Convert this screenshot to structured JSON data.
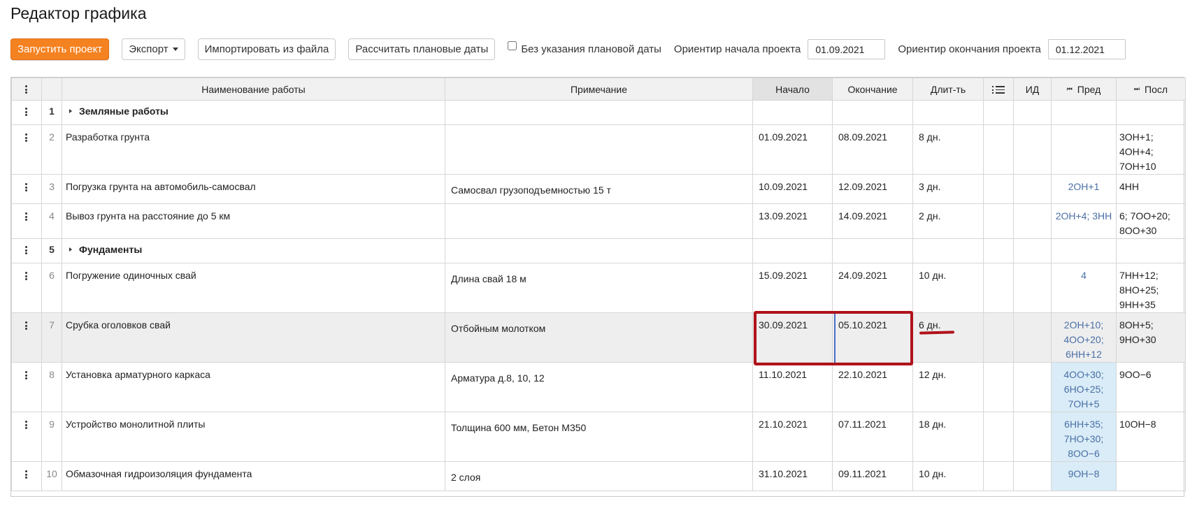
{
  "page": {
    "title": "Редактор графика"
  },
  "toolbar": {
    "run_label": "Запустить проект",
    "export_label": "Экспорт",
    "import_label": "Импортировать из файла",
    "calc_label": "Рассчитать плановые даты",
    "no_plan_date_label": "Без указания плановой даты",
    "no_plan_date_checked": false,
    "start_label": "Ориентир начала проекта",
    "start_value": "01.09.2021",
    "end_label": "Ориентир окончания проекта",
    "end_value": "01.12.2021"
  },
  "colors": {
    "primary": "#f58220",
    "link": "#4a6fa5",
    "highlight_border": "#b0121b",
    "pred_highlight": "#d9ecf7"
  },
  "table": {
    "headers": {
      "name": "Наименование работы",
      "note": "Примечание",
      "start": "Начало",
      "end": "Окончание",
      "duration": "Длит-ть",
      "list_icon": "list-icon",
      "id": "ИД",
      "pred": "Пред",
      "succ": "Посл"
    },
    "rows": [
      {
        "num": "1",
        "group": true,
        "name": "Земляные работы",
        "note": "",
        "start": "",
        "end": "",
        "dur": "",
        "pred": [],
        "succ": []
      },
      {
        "num": "2",
        "name": "Разработка грунта",
        "note": "",
        "start": "01.09.2021",
        "end": "08.09.2021",
        "dur": "8 дн.",
        "pred": [],
        "succ": [
          "3ОН+1;",
          "4ОН+4;",
          "7ОН+10"
        ]
      },
      {
        "num": "3",
        "name": "Погрузка грунта на автомобиль-самосвал",
        "note": "Самосвал грузоподъемностью 15 т",
        "start": "10.09.2021",
        "end": "12.09.2021",
        "dur": "3 дн.",
        "pred": [
          "2ОН+1"
        ],
        "succ": [
          "4НН"
        ]
      },
      {
        "num": "4",
        "name": "Вывоз грунта на расстояние до 5 км",
        "note": "",
        "start": "13.09.2021",
        "end": "14.09.2021",
        "dur": "2 дн.",
        "pred": [
          "2ОН+4; 3НН"
        ],
        "succ": [
          "6; 7ОО+20;",
          "8ОО+30"
        ]
      },
      {
        "num": "5",
        "group": true,
        "name": "Фундаменты",
        "note": "",
        "start": "",
        "end": "",
        "dur": "",
        "pred": [],
        "succ": []
      },
      {
        "num": "6",
        "name": "Погружение одиночных свай",
        "note": "Длина свай 18 м",
        "start": "15.09.2021",
        "end": "24.09.2021",
        "dur": "10 дн.",
        "pred": [
          "4"
        ],
        "succ": [
          "7НН+12;",
          "8НО+25;",
          "9НН+35"
        ]
      },
      {
        "num": "7",
        "selected": true,
        "name": "Срубка оголовков свай",
        "note": "Отбойным молотком",
        "start": "30.09.2021",
        "end": "05.10.2021",
        "dur": "6 дн.",
        "pred": [
          "2ОН+10;",
          "4ОО+20;",
          "6НН+12"
        ],
        "succ": [
          "8ОН+5;",
          "9НО+30"
        ]
      },
      {
        "num": "8",
        "name": "Установка арматурного каркаса",
        "note": "Арматура д.8, 10, 12",
        "start": "11.10.2021",
        "end": "22.10.2021",
        "dur": "12 дн.",
        "predHl": true,
        "pred": [
          "4ОО+30;",
          "6НО+25;",
          "7ОН+5"
        ],
        "succ": [
          "9ОО−6"
        ]
      },
      {
        "num": "9",
        "name": "Устройство монолитной плиты",
        "note": "Толщина 600 мм, Бетон М350",
        "start": "21.10.2021",
        "end": "07.11.2021",
        "dur": "18 дн.",
        "predHl": true,
        "pred": [
          "6НН+35;",
          "7НО+30;",
          "8ОО−6"
        ],
        "succ": [
          "10ОН−8"
        ]
      },
      {
        "num": "10",
        "name": "Обмазочная гидроизоляция фундамента",
        "note": "2 слоя",
        "start": "31.10.2021",
        "end": "09.11.2021",
        "dur": "10 дн.",
        "predHl": true,
        "pred": [
          "9ОН−8"
        ],
        "succ": []
      }
    ]
  }
}
